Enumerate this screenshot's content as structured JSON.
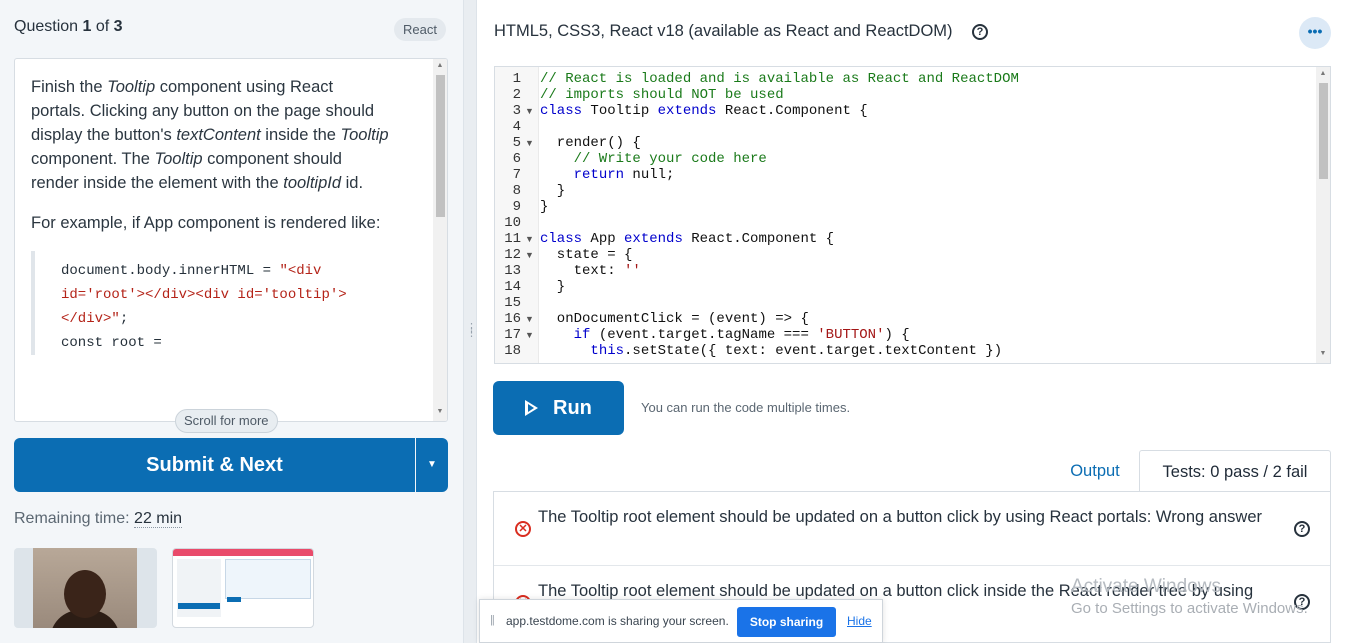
{
  "question": {
    "prefix": "Question ",
    "number": "1",
    "of": " of ",
    "total": "3",
    "tag": "React",
    "paragraphs": [
      [
        {
          "t": "Finish the ",
          "i": false
        },
        {
          "t": "Tooltip",
          "i": true
        },
        {
          "t": " component using React portals. Clicking any button on the page should display the button's ",
          "i": false
        },
        {
          "t": "textContent",
          "i": true
        },
        {
          "t": " inside the ",
          "i": false
        },
        {
          "t": "Tooltip",
          "i": true
        },
        {
          "t": " component. The ",
          "i": false
        },
        {
          "t": "Tooltip",
          "i": true
        },
        {
          "t": " component should render inside the element with the ",
          "i": false
        },
        {
          "t": "tooltipId",
          "i": true
        },
        {
          "t": " id.",
          "i": false
        }
      ],
      [
        {
          "t": "For example, if App component is rendered like:",
          "i": false
        }
      ]
    ],
    "code_prefix": "document.body.innerHTML = ",
    "code_string": "\"<div id='root'></div><div id='tooltip'></div>\"",
    "code_suffix": ";",
    "code_line2": "const root = ",
    "scroll_hint": "Scroll for more"
  },
  "actions": {
    "submit_label": "Submit & Next",
    "dropdown_icon": "caret-down-icon"
  },
  "timer": {
    "label": "Remaining time: ",
    "value": "22 min"
  },
  "editor": {
    "title": "HTML5, CSS3, React v18 (available as React and ReactDOM)",
    "help_glyph": "?",
    "more_glyph": "•••",
    "lines": [
      {
        "n": "1",
        "fold": false,
        "tokens": [
          {
            "c": "c",
            "t": "// React is loaded and is available as React and ReactDOM"
          }
        ]
      },
      {
        "n": "2",
        "fold": false,
        "tokens": [
          {
            "c": "c",
            "t": "// imports should NOT be used"
          }
        ]
      },
      {
        "n": "3",
        "fold": true,
        "tokens": [
          {
            "c": "k",
            "t": "class"
          },
          {
            "c": "",
            "t": " Tooltip "
          },
          {
            "c": "k",
            "t": "extends"
          },
          {
            "c": "",
            "t": " React.Component {"
          }
        ]
      },
      {
        "n": "4",
        "fold": false,
        "tokens": []
      },
      {
        "n": "5",
        "fold": true,
        "tokens": [
          {
            "c": "",
            "t": "  render() {"
          }
        ]
      },
      {
        "n": "6",
        "fold": false,
        "tokens": [
          {
            "c": "c",
            "t": "    // Write your code here"
          }
        ]
      },
      {
        "n": "7",
        "fold": false,
        "tokens": [
          {
            "c": "",
            "t": "    "
          },
          {
            "c": "k",
            "t": "return"
          },
          {
            "c": "",
            "t": " null;"
          }
        ]
      },
      {
        "n": "8",
        "fold": false,
        "tokens": [
          {
            "c": "",
            "t": "  }"
          }
        ]
      },
      {
        "n": "9",
        "fold": false,
        "tokens": [
          {
            "c": "",
            "t": "}"
          }
        ]
      },
      {
        "n": "10",
        "fold": false,
        "tokens": []
      },
      {
        "n": "11",
        "fold": true,
        "tokens": [
          {
            "c": "k",
            "t": "class"
          },
          {
            "c": "",
            "t": " App "
          },
          {
            "c": "k",
            "t": "extends"
          },
          {
            "c": "",
            "t": " React.Component {"
          }
        ]
      },
      {
        "n": "12",
        "fold": true,
        "tokens": [
          {
            "c": "",
            "t": "  state = {"
          }
        ]
      },
      {
        "n": "13",
        "fold": false,
        "tokens": [
          {
            "c": "",
            "t": "    text: "
          },
          {
            "c": "s2",
            "t": "''"
          }
        ]
      },
      {
        "n": "14",
        "fold": false,
        "tokens": [
          {
            "c": "",
            "t": "  }"
          }
        ]
      },
      {
        "n": "15",
        "fold": false,
        "tokens": []
      },
      {
        "n": "16",
        "fold": true,
        "tokens": [
          {
            "c": "",
            "t": "  onDocumentClick = (event) => {"
          }
        ]
      },
      {
        "n": "17",
        "fold": true,
        "tokens": [
          {
            "c": "",
            "t": "    "
          },
          {
            "c": "k",
            "t": "if"
          },
          {
            "c": "",
            "t": " (event.target.tagName === "
          },
          {
            "c": "s2",
            "t": "'BUTTON'"
          },
          {
            "c": "",
            "t": ") {"
          }
        ]
      },
      {
        "n": "18",
        "fold": false,
        "tokens": [
          {
            "c": "",
            "t": "      "
          },
          {
            "c": "k",
            "t": "this"
          },
          {
            "c": "",
            "t": ".setState({ text: event.target.textContent })"
          }
        ]
      }
    ]
  },
  "run": {
    "label": "Run",
    "hint": "You can run the code multiple times."
  },
  "tabs": {
    "output": "Output",
    "tests": "Tests: 0 pass / 2 fail"
  },
  "tests": [
    {
      "status": "fail",
      "text": "The Tooltip root element should be updated on a button click by using React portals: Wrong answer"
    },
    {
      "status": "fail",
      "text": "The Tooltip root element should be updated on a button click inside the React render tree by using React portals: Wrong answer"
    }
  ],
  "watermark": {
    "title": "Activate Windows",
    "subtitle": "Go to Settings to activate Windows."
  },
  "share_bar": {
    "message": "app.testdome.com is sharing your screen.",
    "stop_label": "Stop sharing",
    "hide_label": "Hide"
  },
  "colors": {
    "primary": "#0b6db3",
    "fail": "#d92d20",
    "share_button": "#1a73e8"
  }
}
